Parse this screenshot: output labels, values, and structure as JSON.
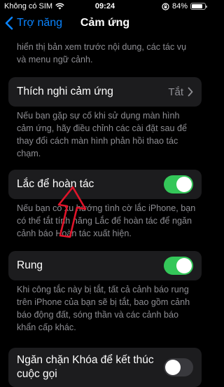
{
  "status_bar": {
    "carrier": "Không có SIM",
    "time": "09:24",
    "battery": "84%",
    "battery_level": 0.84
  },
  "nav": {
    "back_label": "Trợ năng",
    "title": "Cảm ứng"
  },
  "top_description": "hiển thị bản xem trước nội dung, các tác vụ\nvà menu ngữ cảnh.",
  "sections": {
    "touch_accommodations": {
      "label": "Thích nghi cảm ứng",
      "value": "Tắt",
      "description": "Nếu bạn gặp sự cố khi sử dụng màn hình\ncảm ứng, hãy điều chỉnh các cài đặt sau để\nthay đổi cách màn hình phản hồi thao tác\nchạm."
    },
    "shake_to_undo": {
      "label": "Lắc để hoàn tác",
      "enabled": true,
      "description": "Nếu bạn có xu hướng tình cờ lắc iPhone, bạn\ncó thể tắt tính năng Lắc để hoàn tác để ngăn\ncảnh báo Hoàn tác xuất hiện."
    },
    "vibration": {
      "label": "Rung",
      "enabled": true,
      "description": "Khi công tắc này bị tắt, tất cả cảnh báo rung\ntrên iPhone của bạn sẽ bị tắt, bao gồm cảnh\nbáo động đất, sóng thần và các cảnh báo\nkhẩn cấp khác."
    },
    "prevent_lock": {
      "label": "Ngăn chặn Khóa để kết thúc\ncuộc gọi",
      "enabled": false
    }
  },
  "colors": {
    "accent": "#0a84ff",
    "toggle_on": "#34c759",
    "annotation_arrow": "#e0142a"
  }
}
